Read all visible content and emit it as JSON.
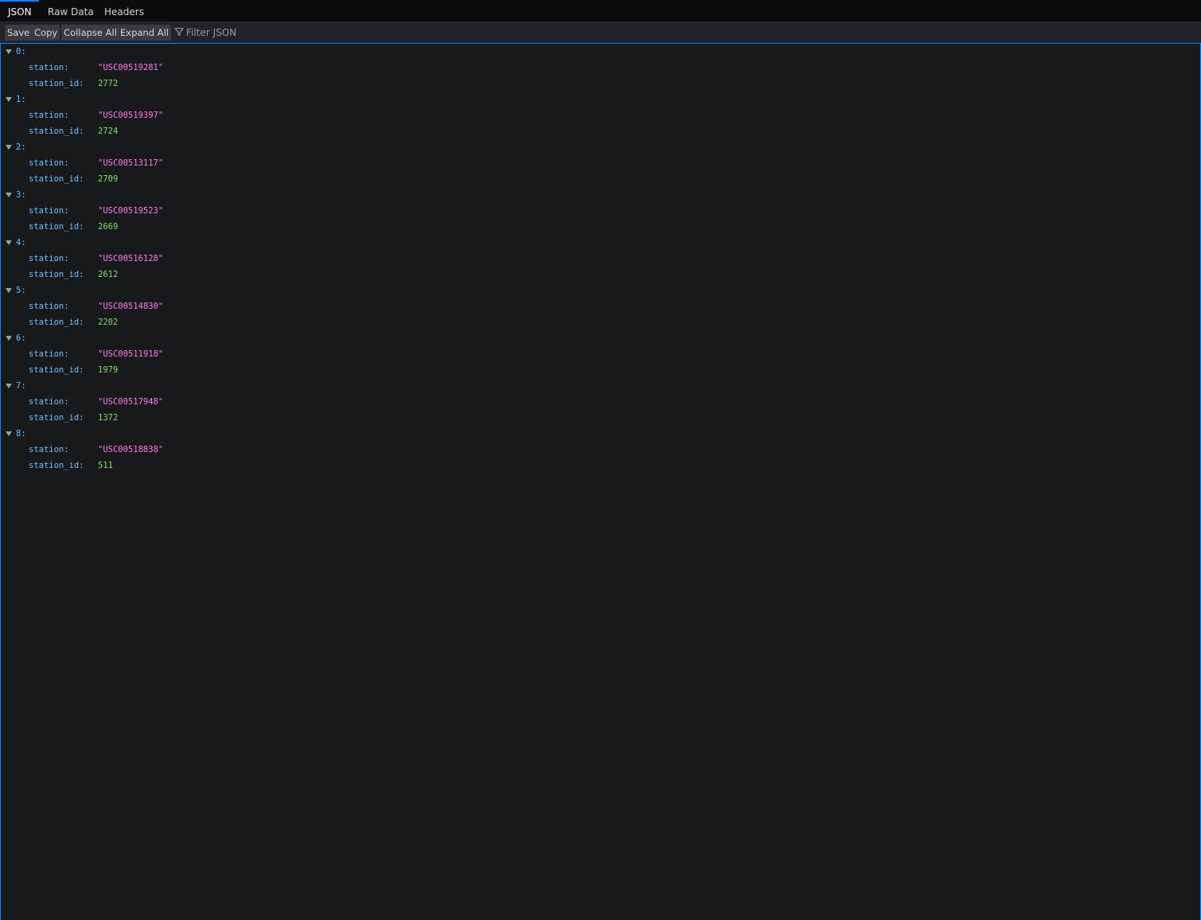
{
  "tabs": [
    {
      "label": "JSON",
      "active": true
    },
    {
      "label": "Raw Data",
      "active": false
    },
    {
      "label": "Headers",
      "active": false
    }
  ],
  "toolbar": {
    "save_label": "Save",
    "copy_label": "Copy",
    "collapse_label": "Collapse All",
    "expand_label": "Expand All",
    "filter_placeholder": "Filter JSON"
  },
  "colors": {
    "accent": "#0a84ff",
    "key": "#75bfff",
    "string": "#ff7de9",
    "number": "#86de74",
    "background": "#18191b"
  },
  "records": [
    {
      "index": "0:",
      "station_key": "station:",
      "station": "\"USC00519281\"",
      "id_key": "station_id:",
      "station_id": "2772"
    },
    {
      "index": "1:",
      "station_key": "station:",
      "station": "\"USC00519397\"",
      "id_key": "station_id:",
      "station_id": "2724"
    },
    {
      "index": "2:",
      "station_key": "station:",
      "station": "\"USC00513117\"",
      "id_key": "station_id:",
      "station_id": "2709"
    },
    {
      "index": "3:",
      "station_key": "station:",
      "station": "\"USC00519523\"",
      "id_key": "station_id:",
      "station_id": "2669"
    },
    {
      "index": "4:",
      "station_key": "station:",
      "station": "\"USC00516128\"",
      "id_key": "station_id:",
      "station_id": "2612"
    },
    {
      "index": "5:",
      "station_key": "station:",
      "station": "\"USC00514830\"",
      "id_key": "station_id:",
      "station_id": "2202"
    },
    {
      "index": "6:",
      "station_key": "station:",
      "station": "\"USC00511918\"",
      "id_key": "station_id:",
      "station_id": "1979"
    },
    {
      "index": "7:",
      "station_key": "station:",
      "station": "\"USC00517948\"",
      "id_key": "station_id:",
      "station_id": "1372"
    },
    {
      "index": "8:",
      "station_key": "station:",
      "station": "\"USC00518838\"",
      "id_key": "station_id:",
      "station_id": "511"
    }
  ]
}
